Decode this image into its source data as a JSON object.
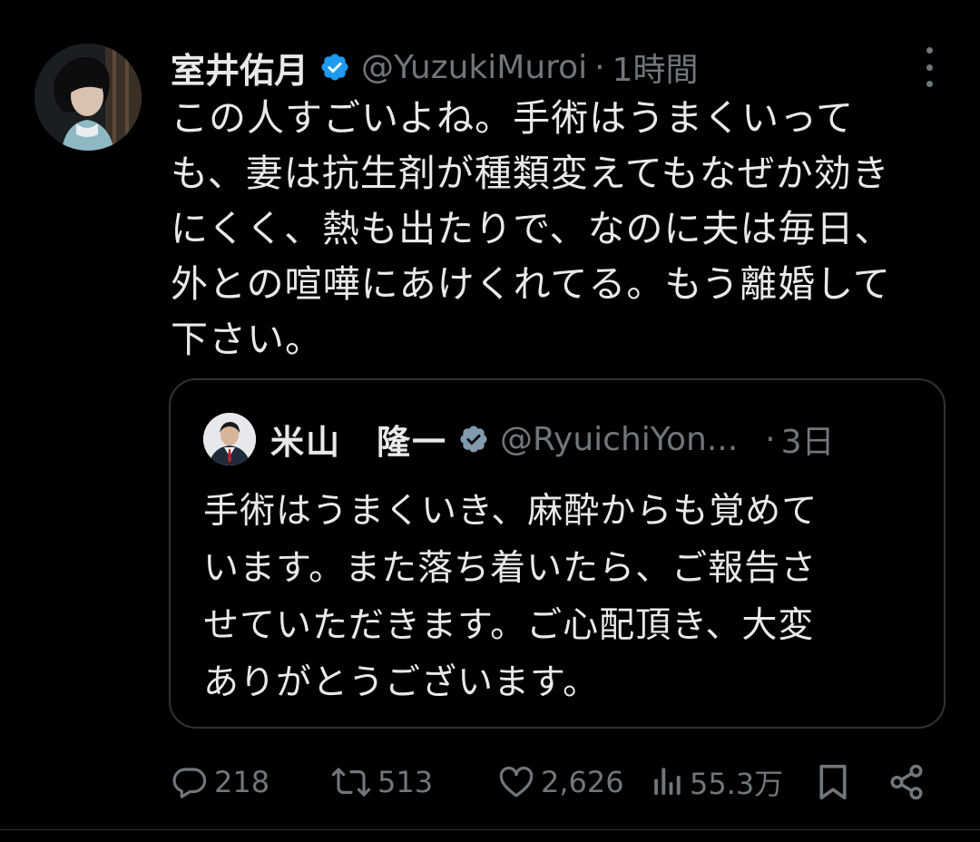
{
  "tweet": {
    "author": {
      "display_name": "室井佑月",
      "handle": "@YuzukiMuroi",
      "time": "1時間",
      "verified": true
    },
    "text_lines": [
      "この人すごいよね。手術はうまくいって",
      "も、妻は抗生剤が種類変えてもなぜか効き",
      "にくく、熱も出たりで、なのに夫は毎日、",
      "外との喧嘩にあけくれてる。もう離婚して",
      "下さい。"
    ],
    "quoted": {
      "display_name": "米山　隆一",
      "handle": "@RyuichiYon...",
      "time": "3日",
      "verified": true,
      "text_lines": [
        "手術はうまくいき、麻酔からも覚めて",
        "います。また落ち着いたら、ご報告さ",
        "せていただきます。ご心配頂き、大変",
        "ありがとうございます。"
      ]
    },
    "actions": {
      "replies": "218",
      "reposts": "513",
      "likes": "2,626",
      "views": "55.3万"
    },
    "separator": "·"
  },
  "colors": {
    "background": "#000000",
    "text_primary": "#e7e9ea",
    "text_secondary": "#71767b",
    "border": "#2f3336",
    "verified_primary": "#1d9bf0",
    "verified_quoted": "#829aab"
  }
}
